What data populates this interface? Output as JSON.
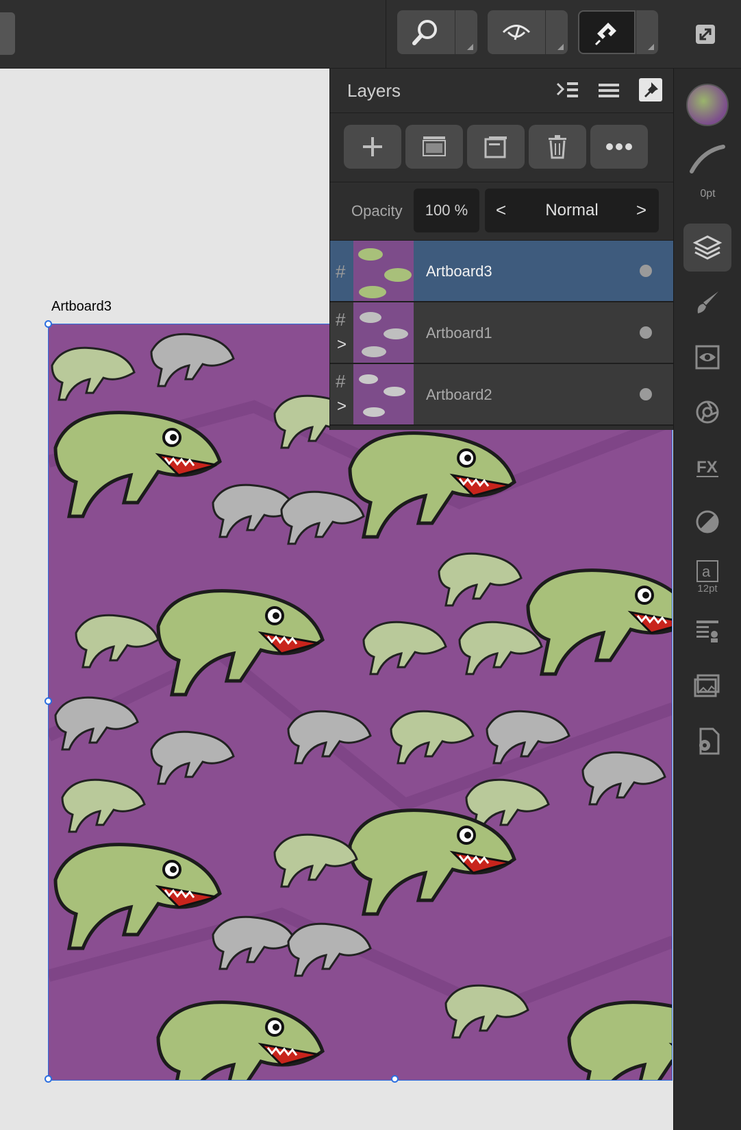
{
  "canvas": {
    "artboard_label": "Artboard3"
  },
  "layers_panel": {
    "title": "Layers",
    "opacity_label": "Opacity",
    "opacity_value": "100 %",
    "blend_mode": "Normal",
    "blend_prev": "<",
    "blend_next": ">",
    "layers": [
      {
        "name": "Artboard3",
        "selected": true
      },
      {
        "name": "Artboard1",
        "selected": false
      },
      {
        "name": "Artboard2",
        "selected": false
      }
    ]
  },
  "right_strip": {
    "stroke_width": "0pt",
    "font_size": "12pt"
  },
  "colors": {
    "selection": "#2c6fe0",
    "layer_selected": "#3e5b7d",
    "artboard_bg": "#8a4e91"
  }
}
